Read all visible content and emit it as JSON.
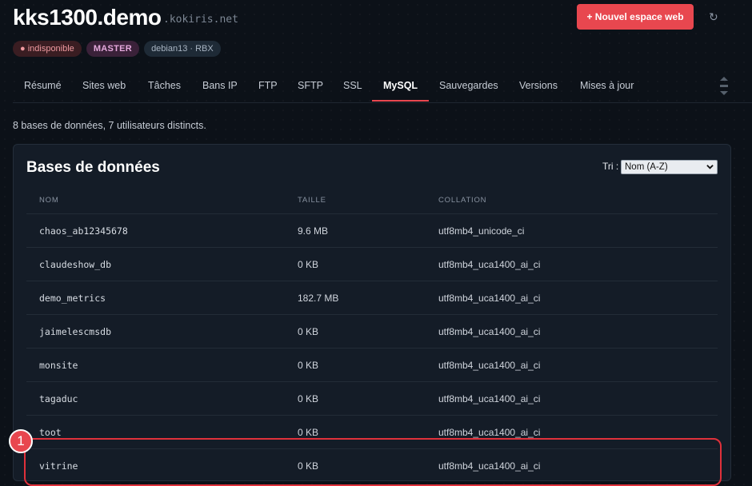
{
  "header": {
    "hostname": "kks1300.demo",
    "domain": ".kokiris.net",
    "new_button_label": "+ Nouvel espace web",
    "refresh_icon": "↻"
  },
  "badges": [
    {
      "label": "● indisponible",
      "type": "status"
    },
    {
      "label": "MASTER",
      "type": "role"
    },
    {
      "label": "debian13 · RBX",
      "type": "os"
    }
  ],
  "tabs": [
    {
      "label": "Résumé"
    },
    {
      "label": "Sites web"
    },
    {
      "label": "Tâches"
    },
    {
      "label": "Bans IP"
    },
    {
      "label": "FTP"
    },
    {
      "label": "SFTP"
    },
    {
      "label": "SSL"
    },
    {
      "label": "MySQL",
      "active": true
    },
    {
      "label": "Sauvegardes"
    },
    {
      "label": "Versions"
    },
    {
      "label": "Mises à jour"
    }
  ],
  "summary": "8 bases de données, 7 utilisateurs distincts.",
  "panel": {
    "title": "Bases de données",
    "sort_label": "Tri :",
    "sort_value": "Nom (A-Z)",
    "columns": [
      "NOM",
      "TAILLE",
      "COLLATION"
    ],
    "rows": [
      {
        "name": "chaos_ab12345678",
        "size": "9.6 MB",
        "collation": "utf8mb4_unicode_ci"
      },
      {
        "name": "claudeshow_db",
        "size": "0 KB",
        "collation": "utf8mb4_uca1400_ai_ci"
      },
      {
        "name": "demo_metrics",
        "size": "182.7 MB",
        "collation": "utf8mb4_uca1400_ai_ci"
      },
      {
        "name": "jaimelescmsdb",
        "size": "0 KB",
        "collation": "utf8mb4_uca1400_ai_ci"
      },
      {
        "name": "monsite",
        "size": "0 KB",
        "collation": "utf8mb4_uca1400_ai_ci"
      },
      {
        "name": "tagaduc",
        "size": "0 KB",
        "collation": "utf8mb4_uca1400_ai_ci"
      },
      {
        "name": "toot",
        "size": "0 KB",
        "collation": "utf8mb4_uca1400_ai_ci"
      },
      {
        "name": "vitrine",
        "size": "0 KB",
        "collation": "utf8mb4_uca1400_ai_ci"
      }
    ]
  },
  "annotation": {
    "marker": "1"
  },
  "colors": {
    "accent": "#e8474f",
    "background": "#0c1118",
    "panel": "#141c27"
  }
}
